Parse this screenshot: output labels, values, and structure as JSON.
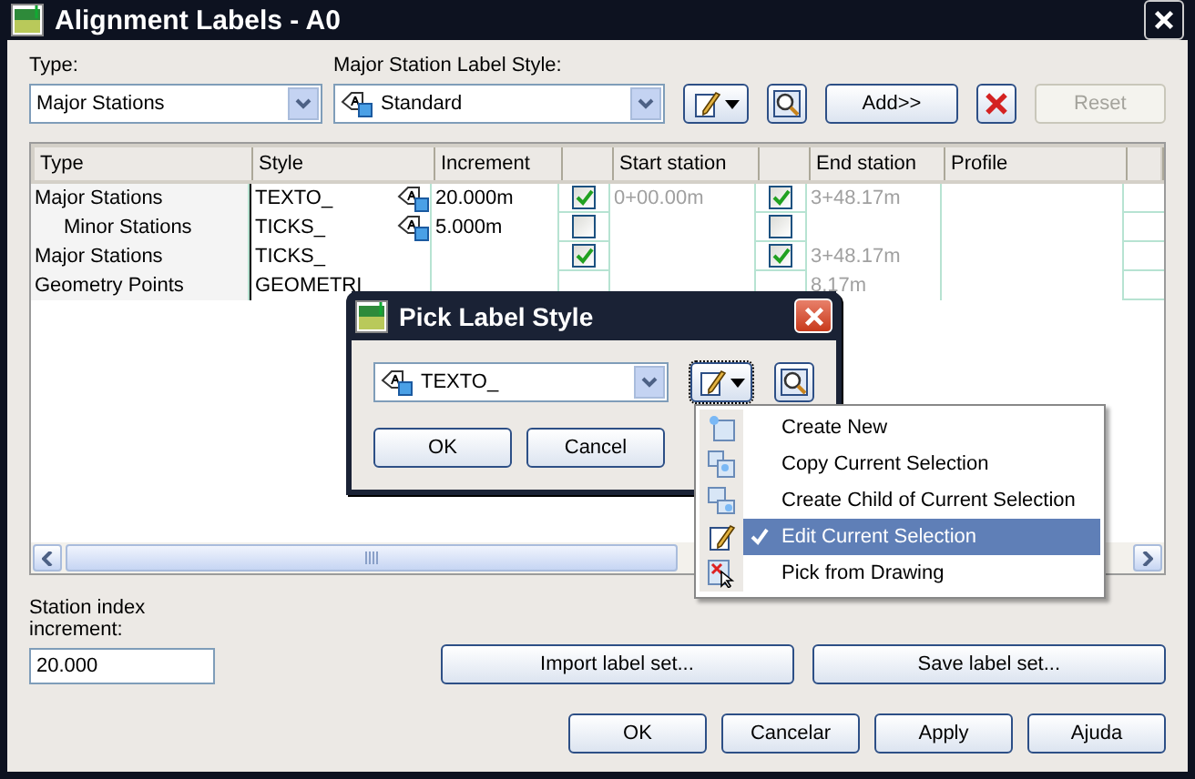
{
  "window": {
    "title": "Alignment Labels - A0"
  },
  "type_field": {
    "label": "Type:",
    "value": "Major Stations"
  },
  "style_field": {
    "label": "Major Station Label Style:",
    "value": "Standard"
  },
  "toolbar_buttons": [
    {
      "label": "Add>>",
      "disabled": false
    },
    {
      "label": "Reset",
      "disabled": true
    }
  ],
  "table": {
    "columns": [
      {
        "kind": "text",
        "label": "Type"
      },
      {
        "kind": "text",
        "label": "Style"
      },
      {
        "kind": "text",
        "label": "Increment"
      },
      {
        "kind": "check"
      },
      {
        "kind": "text",
        "label": "Start station"
      },
      {
        "kind": "check"
      },
      {
        "kind": "text",
        "label": "End station"
      },
      {
        "kind": "text",
        "label": "Profile"
      }
    ],
    "rows": [
      {
        "type": "Major Stations",
        "style": "TEXTO_",
        "increment": "20.000m",
        "start_on": true,
        "start": "0+00.00m",
        "end_on": true,
        "end": "3+48.17m",
        "children": [
          {
            "type": "Minor Stations",
            "style": "TICKS_",
            "increment": "5.000m",
            "start_on": false,
            "end_on": false
          }
        ]
      },
      {
        "type": "Major Stations",
        "style": "TICKS_",
        "start_on": true,
        "end_on": true,
        "end": "3+48.17m"
      },
      {
        "type": "Geometry Points",
        "style": "GEOMETRI",
        "end": "8.17m"
      }
    ]
  },
  "station_index": {
    "label": "Station index increment:",
    "value": "20.000"
  },
  "set_buttons": [
    "Import label set...",
    "Save label set..."
  ],
  "footer_buttons": [
    "OK",
    "Cancelar",
    "Apply",
    "Ajuda"
  ],
  "pick_dialog": {
    "title": "Pick Label Style",
    "value": "TEXTO_",
    "buttons": [
      "OK",
      "Cancel"
    ]
  },
  "menu": [
    {
      "kind": "new",
      "label": "Create New",
      "checked": false,
      "selected": false
    },
    {
      "kind": "copy",
      "label": "Copy Current Selection",
      "checked": false,
      "selected": false
    },
    {
      "kind": "child",
      "label": "Create Child of Current Selection",
      "checked": false,
      "selected": false
    },
    {
      "kind": "edit",
      "label": "Edit Current Selection",
      "checked": true,
      "selected": true
    },
    {
      "kind": "pick",
      "label": "Pick from Drawing",
      "checked": false,
      "selected": false
    }
  ]
}
